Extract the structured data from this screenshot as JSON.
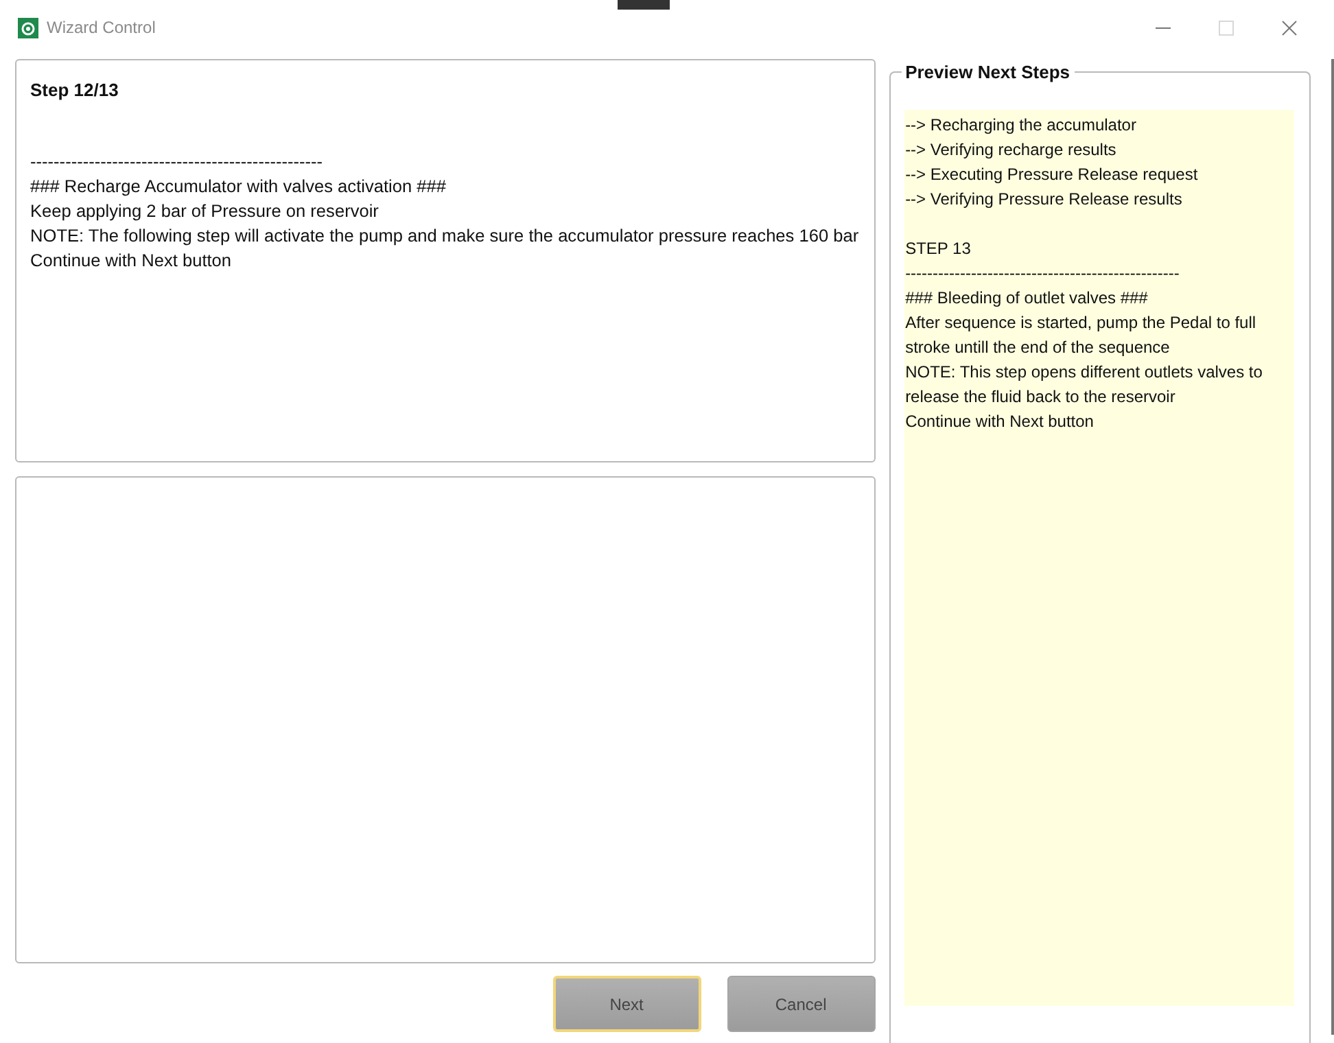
{
  "window": {
    "title": "Wizard Control",
    "controls": [
      {
        "kind": "minimize",
        "disabled": false
      },
      {
        "kind": "maximize",
        "disabled": true
      },
      {
        "kind": "close",
        "disabled": false
      }
    ]
  },
  "step": {
    "title": "Step 12/13",
    "blocks": [
      [
        "--------------------------------------------------",
        "### Recharge Accumulator with valves activation ###",
        "Keep applying 2 bar of Pressure on reservoir",
        "NOTE: The following step will activate the pump and make sure the accumulator pressure reaches 160 bar",
        "Continue with Next button"
      ]
    ]
  },
  "buttons": [
    {
      "label": "Next",
      "focused": true
    },
    {
      "label": "Cancel",
      "focused": false
    }
  ],
  "preview": {
    "title": "Preview Next Steps",
    "blocks": [
      [
        "--> Recharging the accumulator",
        "--> Verifying recharge results",
        "--> Executing Pressure Release request",
        "--> Verifying Pressure Release results"
      ],
      [
        "STEP 13",
        "--------------------------------------------------",
        "### Bleeding of outlet valves ###",
        "After sequence is started, pump the Pedal to full stroke untill the end of the sequence",
        "NOTE: This step opens different outlets valves to release the fluid back to the reservoir",
        "Continue with Next button"
      ]
    ]
  }
}
